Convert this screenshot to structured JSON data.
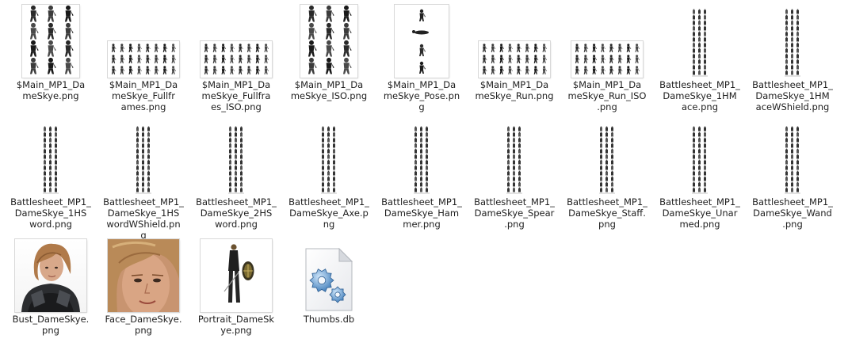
{
  "files": [
    {
      "label": "$Main_MP1_Da\nmeSkye.png",
      "thumb": "sprite-grid-large"
    },
    {
      "label": "$Main_MP1_Da\nmeSkye_Fullfr\names.png",
      "thumb": "sprite-grid-wide"
    },
    {
      "label": "$Main_MP1_Da\nmeSkye_Fullfra\nes_ISO.png",
      "thumb": "sprite-grid-wide"
    },
    {
      "label": "$Main_MP1_Da\nmeSkye_ISO.png",
      "thumb": "sprite-grid-large"
    },
    {
      "label": "$Main_MP1_Da\nmeSkye_Pose.pn\ng",
      "thumb": "sprite-pose"
    },
    {
      "label": "$Main_MP1_Da\nmeSkye_Run.png",
      "thumb": "sprite-grid-wide"
    },
    {
      "label": "$Main_MP1_Da\nmeSkye_Run_ISO\n.png",
      "thumb": "sprite-grid-wide"
    },
    {
      "label": "Battlesheet_MP1_\nDameSkye_1HM\nace.png",
      "thumb": "battlesheet"
    },
    {
      "label": "Battlesheet_MP1_\nDameSkye_1HM\naceWShield.png",
      "thumb": "battlesheet"
    },
    {
      "label": "Battlesheet_MP1_\nDameSkye_1HS\nword.png",
      "thumb": "battlesheet"
    },
    {
      "label": "Battlesheet_MP1_\nDameSkye_1HS\nwordWShield.pn\ng",
      "thumb": "battlesheet"
    },
    {
      "label": "Battlesheet_MP1_\nDameSkye_2HS\nword.png",
      "thumb": "battlesheet"
    },
    {
      "label": "Battlesheet_MP1_\nDameSkye_Axe.p\nng",
      "thumb": "battlesheet"
    },
    {
      "label": "Battlesheet_MP1_\nDameSkye_Ham\nmer.png",
      "thumb": "battlesheet"
    },
    {
      "label": "Battlesheet_MP1_\nDameSkye_Spear\n.png",
      "thumb": "battlesheet"
    },
    {
      "label": "Battlesheet_MP1_\nDameSkye_Staff.\npng",
      "thumb": "battlesheet"
    },
    {
      "label": "Battlesheet_MP1_\nDameSkye_Unar\nmed.png",
      "thumb": "battlesheet"
    },
    {
      "label": "Battlesheet_MP1_\nDameSkye_Wand\n.png",
      "thumb": "battlesheet"
    },
    {
      "label": "Bust_DameSkye.\npng",
      "thumb": "bust"
    },
    {
      "label": "Face_DameSkye.\npng",
      "thumb": "face"
    },
    {
      "label": "Portrait_DameSk\nye.png",
      "thumb": "portrait"
    },
    {
      "label": "Thumbs.db",
      "thumb": "settings-file-icon"
    }
  ]
}
